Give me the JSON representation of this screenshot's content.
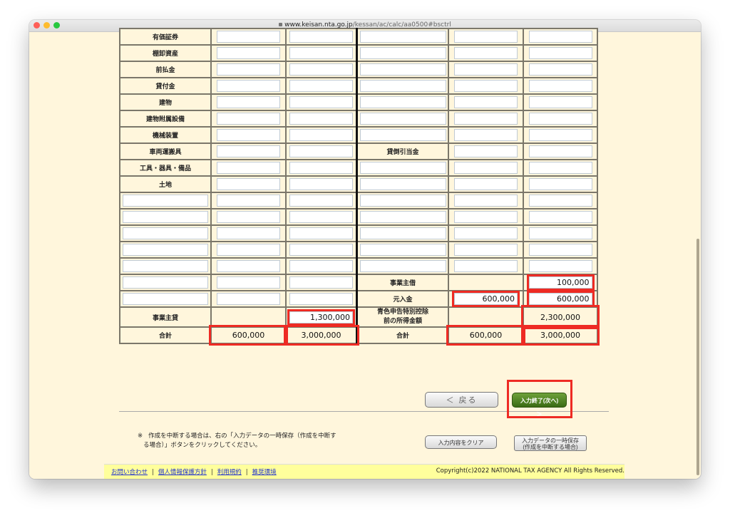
{
  "browser": {
    "url_host": "www.keisan.nta.go.jp",
    "url_path": "/kessan/ac/calc/aa0500#bsctrl"
  },
  "colors": {
    "page_bg": "#fff6dc",
    "highlight": "#ee2b24",
    "next_button": "#4f8226",
    "footer_bg": "#ffff9c",
    "link": "#2233cc"
  },
  "table": {
    "rows": [
      {
        "left_label": "有価証券",
        "left_v1": "",
        "left_v2": "",
        "right_label": "",
        "right_v1": "",
        "right_v2": ""
      },
      {
        "left_label": "棚卸資産",
        "left_v1": "",
        "left_v2": "",
        "right_label": "",
        "right_v1": "",
        "right_v2": ""
      },
      {
        "left_label": "前払金",
        "left_v1": "",
        "left_v2": "",
        "right_label": "",
        "right_v1": "",
        "right_v2": ""
      },
      {
        "left_label": "貸付金",
        "left_v1": "",
        "left_v2": "",
        "right_label": "",
        "right_v1": "",
        "right_v2": ""
      },
      {
        "left_label": "建物",
        "left_v1": "",
        "left_v2": "",
        "right_label": "",
        "right_v1": "",
        "right_v2": ""
      },
      {
        "left_label": "建物附属設備",
        "left_v1": "",
        "left_v2": "",
        "right_label": "",
        "right_v1": "",
        "right_v2": ""
      },
      {
        "left_label": "機械装置",
        "left_v1": "",
        "left_v2": "",
        "right_label": "",
        "right_v1": "",
        "right_v2": ""
      },
      {
        "left_label": "車両運搬具",
        "left_v1": "",
        "left_v2": "",
        "right_label": "貸倒引当金",
        "right_v1": "",
        "right_v2": ""
      },
      {
        "left_label": "工具・器具・備品",
        "left_v1": "",
        "left_v2": "",
        "right_label": "",
        "right_v1": "",
        "right_v2": ""
      },
      {
        "left_label": "土地",
        "left_v1": "",
        "left_v2": "",
        "right_label": "",
        "right_v1": "",
        "right_v2": ""
      }
    ],
    "blank_rows": 5,
    "owner_loan_row": {
      "right_label": "事業主借",
      "right_v2": "100,000"
    },
    "capital_row": {
      "right_label": "元入金",
      "right_v1": "600,000",
      "right_v2": "600,000"
    },
    "owner_draw_row": {
      "left_label": "事業主貸",
      "left_v2": "1,300,000",
      "right_label": "青色申告特別控除前の所得金額",
      "right_label_line1": "青色申告特別控除",
      "right_label_line2": "前の所得金額",
      "right_v2": "2,300,000"
    },
    "total_row": {
      "left_label": "合計",
      "left_v1": "600,000",
      "left_v2": "3,000,000",
      "right_label": "合計",
      "right_v1": "600,000",
      "right_v2": "3,000,000"
    }
  },
  "buttons": {
    "back": "＜ 戻る",
    "next": "入力終了(次へ) ＞",
    "clear": "入力内容をクリア",
    "save_line1": "入力データの一時保存",
    "save_line2": "(作成を中断する場合)"
  },
  "note": {
    "mark": "※",
    "line1": "作成を中断する場合は、右の「入力データの一時保存（作成を中断す",
    "line2": "る場合）」ボタンをクリックしてください。"
  },
  "footer": {
    "links": [
      "お問い合わせ",
      "個人情報保護方針",
      "利用規約",
      "推奨環境"
    ],
    "separator": "|",
    "copyright": "Copyright(c)2022 NATIONAL TAX AGENCY All Rights Reserved."
  }
}
